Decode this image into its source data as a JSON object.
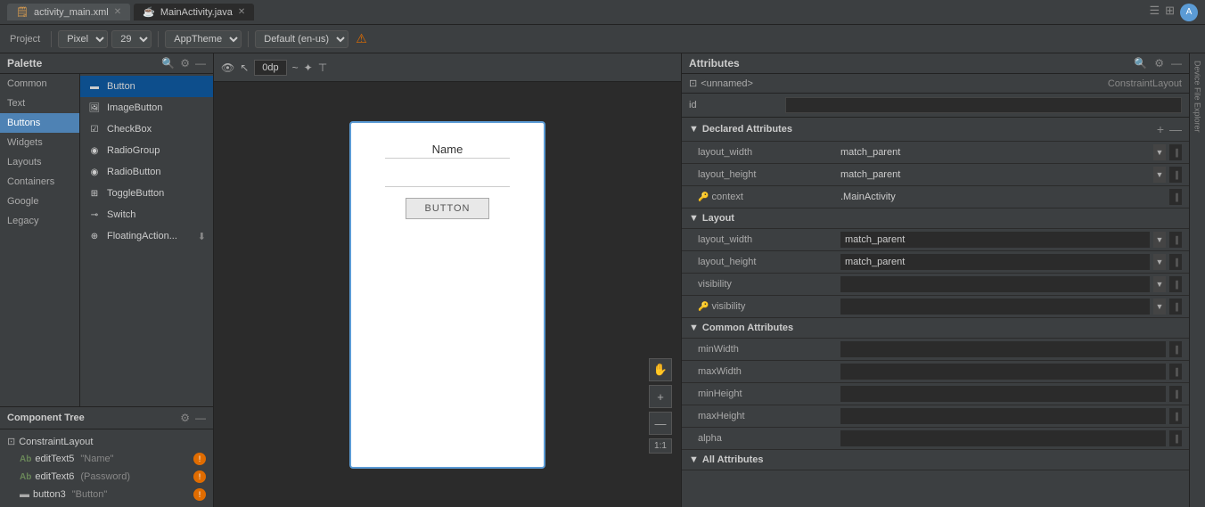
{
  "titlebar": {
    "tabs": [
      {
        "id": "tab-xml",
        "label": "activity_main.xml",
        "active": false
      },
      {
        "id": "tab-java",
        "label": "MainActivity.java",
        "active": true
      }
    ]
  },
  "toolbar": {
    "palette_icon": "☰",
    "grid_icon": "⊞",
    "avatar_icon": "👤",
    "project_label": "Project",
    "device_label": "Pixel ▾",
    "api_label": "29 ▾",
    "theme_label": "AppTheme ▾",
    "locale_label": "Default (en-us) ▾",
    "warning_icon": "⚠"
  },
  "palette": {
    "title": "Palette",
    "search_icon": "🔍",
    "settings_icon": "⚙",
    "close_icon": "—",
    "filter_icon": "⊿",
    "categories": [
      {
        "id": "common",
        "label": "Common",
        "active": false
      },
      {
        "id": "text",
        "label": "Text",
        "active": false
      },
      {
        "id": "buttons",
        "label": "Buttons",
        "active": true
      }
    ],
    "items": [
      {
        "id": "button",
        "label": "Button",
        "icon": "▬",
        "selected": true
      },
      {
        "id": "imagebutton",
        "label": "ImageButton",
        "icon": "🖼"
      },
      {
        "id": "checkbox",
        "label": "CheckBox",
        "icon": "☑"
      },
      {
        "id": "radiogroup",
        "label": "RadioGroup",
        "icon": "◉"
      },
      {
        "id": "radiobutton",
        "label": "RadioButton",
        "icon": "◉"
      },
      {
        "id": "togglebutton",
        "label": "ToggleButton",
        "icon": "⊞"
      },
      {
        "id": "switch",
        "label": "Switch",
        "icon": "⊸"
      },
      {
        "id": "floatingaction",
        "label": "FloatingAction...",
        "icon": "⊕"
      }
    ]
  },
  "canvas_toolbar": {
    "eye_icon": "👁",
    "cursor_icon": "↖",
    "size_value": "0dp",
    "wave_icon": "~",
    "magic_icon": "✦",
    "align_icon": "⊤"
  },
  "device_canvas": {
    "widget_name_placeholder": "Name",
    "widget_button_label": "BUTTON"
  },
  "canvas_controls": {
    "hand_icon": "✋",
    "plus_icon": "+",
    "minus_icon": "—",
    "zoom_label": "1:1"
  },
  "component_tree": {
    "title": "Component Tree",
    "settings_icon": "⚙",
    "close_icon": "—",
    "items": [
      {
        "id": "constraint-layout",
        "label": "ConstraintLayout",
        "icon": "⊡",
        "indent": 0,
        "type": "layout"
      },
      {
        "id": "edit-text5",
        "label": "editText5",
        "detail": "\"Name\"",
        "icon": "Ab",
        "indent": 1,
        "error": true
      },
      {
        "id": "edit-text6",
        "label": "editText6",
        "detail": "(Password)",
        "icon": "Ab",
        "indent": 1,
        "error": true
      },
      {
        "id": "button3",
        "label": "button3",
        "detail": "\"Button\"",
        "icon": "▬",
        "indent": 1,
        "error": true
      }
    ]
  },
  "attributes": {
    "title": "Attributes",
    "search_icon": "🔍",
    "settings_icon": "⚙",
    "close_icon": "—",
    "component_name": "<unnamed>",
    "component_icon": "⊡",
    "component_type": "ConstraintLayout",
    "id_label": "id",
    "id_value": "",
    "sections": [
      {
        "id": "declared",
        "title": "Declared Attributes",
        "collapsed": false,
        "add_icon": "+",
        "remove_icon": "—",
        "rows": [
          {
            "id": "layout_width_decl",
            "name": "layout_width",
            "value": "match_parent",
            "has_dropdown": true,
            "has_extra": true,
            "lock": false
          },
          {
            "id": "layout_height_decl",
            "name": "layout_height",
            "value": "match_parent",
            "has_dropdown": true,
            "has_extra": true,
            "lock": false
          },
          {
            "id": "context",
            "name": "context",
            "value": ".MainActivity",
            "has_dropdown": false,
            "has_extra": true,
            "lock": true
          }
        ]
      },
      {
        "id": "layout",
        "title": "Layout",
        "collapsed": false,
        "rows": [
          {
            "id": "layout_width_lay",
            "name": "layout_width",
            "value": "match_parent",
            "has_dropdown": true,
            "has_extra": true,
            "lock": false
          },
          {
            "id": "layout_height_lay",
            "name": "layout_height",
            "value": "match_parent",
            "has_dropdown": true,
            "has_extra": true,
            "lock": false
          },
          {
            "id": "visibility",
            "name": "visibility",
            "value": "",
            "has_dropdown": true,
            "has_extra": true,
            "lock": false
          },
          {
            "id": "visibility_lock",
            "name": "visibility",
            "value": "",
            "has_dropdown": true,
            "has_extra": true,
            "lock": true
          }
        ]
      },
      {
        "id": "common-attrs",
        "title": "Common Attributes",
        "collapsed": false,
        "rows": [
          {
            "id": "minWidth",
            "name": "minWidth",
            "value": "",
            "has_dropdown": false,
            "has_extra": true,
            "lock": false
          },
          {
            "id": "maxWidth",
            "name": "maxWidth",
            "value": "",
            "has_dropdown": false,
            "has_extra": true,
            "lock": false
          },
          {
            "id": "minHeight",
            "name": "minHeight",
            "value": "",
            "has_dropdown": false,
            "has_extra": true,
            "lock": false
          },
          {
            "id": "maxHeight",
            "name": "maxHeight",
            "value": "",
            "has_dropdown": false,
            "has_extra": true,
            "lock": false
          },
          {
            "id": "alpha",
            "name": "alpha",
            "value": "",
            "has_dropdown": false,
            "has_extra": true,
            "lock": false
          }
        ]
      },
      {
        "id": "all-attrs",
        "title": "All Attributes",
        "collapsed": false,
        "rows": []
      }
    ]
  },
  "far_right": {
    "label": "Device File Explorer"
  }
}
